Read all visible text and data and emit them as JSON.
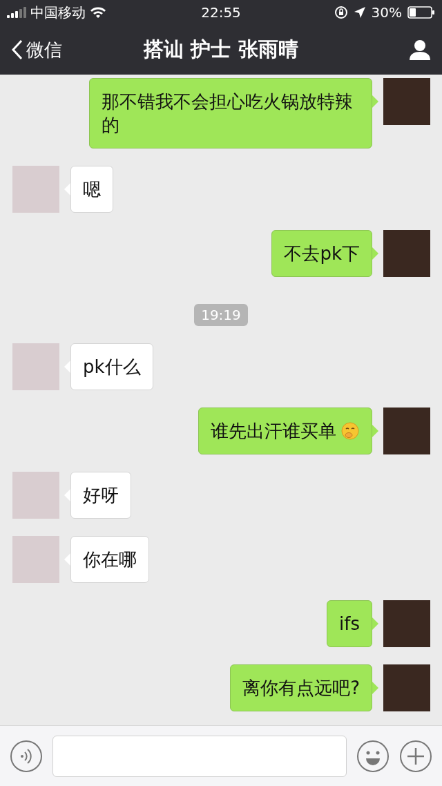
{
  "status_bar": {
    "carrier": "中国移动",
    "time": "22:55",
    "battery_text": "30%",
    "battery": {
      "level": 0.3
    }
  },
  "nav": {
    "back_label": "微信",
    "title": "搭讪 护士 张雨晴"
  },
  "messages": [
    {
      "kind": "sent",
      "text": "那不错我不会担心吃火锅放特辣的"
    },
    {
      "kind": "received",
      "text": "嗯"
    },
    {
      "kind": "sent",
      "text": "不去pk下"
    },
    {
      "kind": "time",
      "text": "19:19"
    },
    {
      "kind": "received",
      "text": "pk什么"
    },
    {
      "kind": "sent",
      "text": "谁先出汗谁买单",
      "emoji": true
    },
    {
      "kind": "received",
      "text": "好呀"
    },
    {
      "kind": "received",
      "text": "你在哪"
    },
    {
      "kind": "sent",
      "text": "ifs"
    },
    {
      "kind": "sent",
      "text": "离你有点远吧?"
    }
  ]
}
